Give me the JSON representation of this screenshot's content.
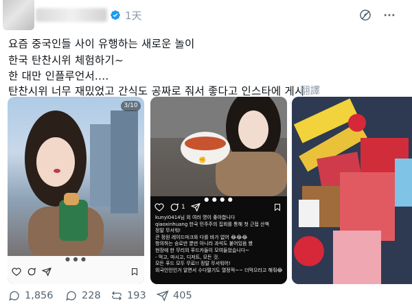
{
  "post": {
    "time": "1天",
    "lines": [
      "요즘 중국인들 사이 유행하는 새로운 놀이",
      "한국 탄찬시위 체험하기~",
      "한 대만 인플루언서....",
      "탄찬시위 너무 재밌었고 간식도 공짜로 줘서 좋다고 인스타에 게시"
    ],
    "translate_label": "翻譯"
  },
  "photos": {
    "photo1": {
      "counter": "3/10"
    },
    "photo2": {
      "like_count": "1",
      "comments": [
        "kunyi0414님 외 여러 명이 좋아합니다",
        "qiaoxinhuang 한국 민주주의 집회를 통해 첫 근접 산책",
        "정말 무서워!",
        "큰 정원 레이드마크와 다를 바가 없어 😂😂😂",
        "항의하는 승로만 뿐만 아니라 과석도 붙어있음 봤",
        "현장에 한 무리의 푸드카들이 모여들었습니다~",
        "- 먹고, 마시고, 디저트, 모든 것.",
        "모든 푸드 모두 무료!! 정말 무서워어!",
        "외국인인인거 알면서 수다떨기도 열정적~~ 더먹으라고 해줘😂"
      ]
    }
  },
  "actions": {
    "replies_views": "1,856",
    "comments": "228",
    "reposts": "193",
    "likes": "405"
  },
  "icons": [
    "verified-icon",
    "grok-icon",
    "more-icon",
    "heart-icon",
    "comment-icon",
    "share-icon",
    "bookmark-icon",
    "views-icon",
    "reply-icon",
    "repost-icon",
    "like-icon"
  ],
  "colors": {
    "verified": "#1d9bf0",
    "muted": "#536471"
  }
}
